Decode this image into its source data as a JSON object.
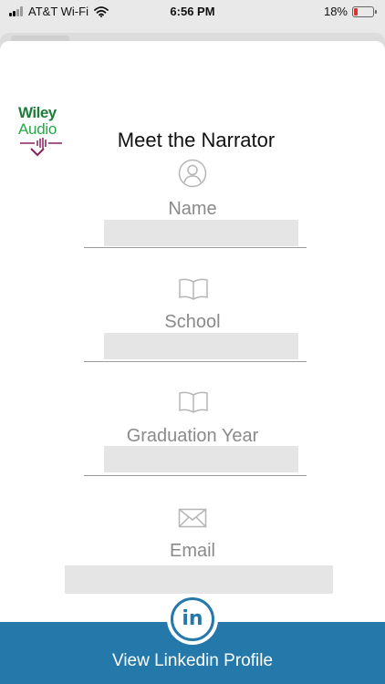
{
  "status_bar": {
    "carrier": "AT&T Wi-Fi",
    "time": "6:56 PM",
    "battery_percent": "18%",
    "battery_level": 0.18,
    "icons": [
      "signal-icon",
      "wifi-icon",
      "battery-icon"
    ]
  },
  "logo": {
    "line1": "Wiley",
    "line2": "Audio",
    "colors": {
      "wiley": "#1f7a3c",
      "audio": "#2aa84a",
      "mark": "#8a1f5c"
    }
  },
  "modal": {
    "title": "Meet the Narrator",
    "fields": [
      {
        "label": "Name",
        "icon": "person-icon",
        "value": ""
      },
      {
        "label": "School",
        "icon": "book-icon",
        "value": ""
      },
      {
        "label": "Graduation Year",
        "icon": "book-icon",
        "value": ""
      },
      {
        "label": "Email",
        "icon": "envelope-icon",
        "value": ""
      }
    ]
  },
  "footer": {
    "button_icon": "linkedin-icon",
    "button_icon_text": "in",
    "label": "View Linkedin Profile",
    "color": "#2478aa"
  }
}
